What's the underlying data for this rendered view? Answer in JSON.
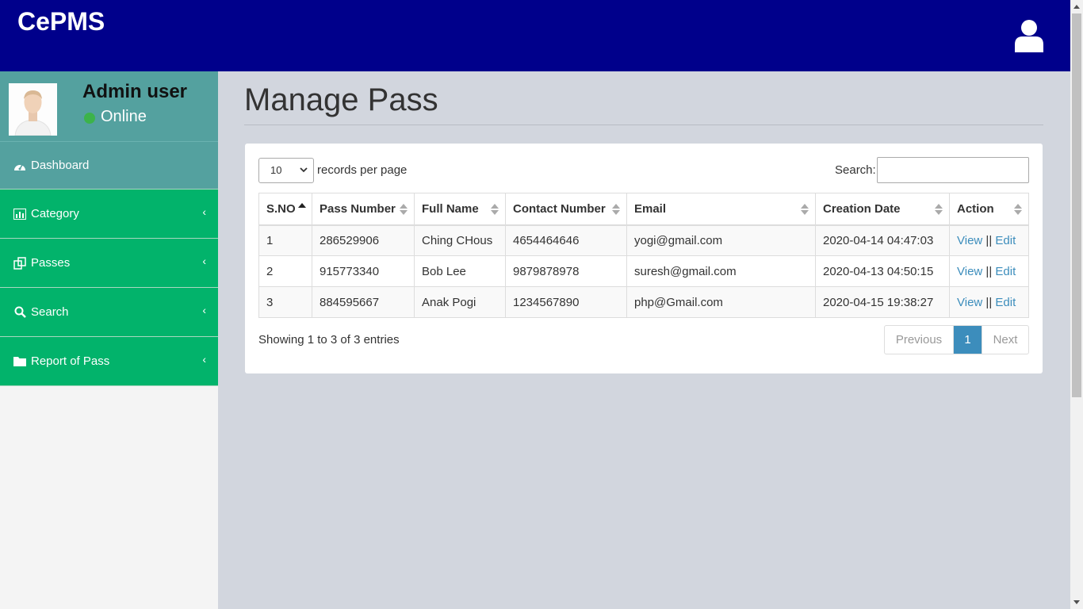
{
  "header": {
    "brand": "CePMS",
    "user_icon": "user-icon"
  },
  "sidebar": {
    "user": {
      "name": "Admin user",
      "status": "Online",
      "status_color": "#3cb34a"
    },
    "items": [
      {
        "label": "Dashboard",
        "icon": "dashboard-icon"
      },
      {
        "label": "Category",
        "icon": "bar-chart-icon"
      },
      {
        "label": "Passes",
        "icon": "copy-icon"
      },
      {
        "label": "Search",
        "icon": "search-icon"
      },
      {
        "label": "Report of Pass",
        "icon": "folder-icon"
      }
    ]
  },
  "page": {
    "title": "Manage Pass"
  },
  "table_controls": {
    "length_value": "10",
    "length_text": "records per page",
    "search_label": "Search:",
    "search_value": ""
  },
  "table": {
    "columns": [
      "S.NO",
      "Pass Number",
      "Full Name",
      "Contact Number",
      "Email",
      "Creation Date",
      "Action"
    ],
    "rows": [
      {
        "sno": "1",
        "pass_number": "286529906",
        "full_name": "Ching CHous",
        "contact": "4654464646",
        "email": "yogi@gmail.com",
        "created": "2020-04-14 04:47:03"
      },
      {
        "sno": "2",
        "pass_number": "915773340",
        "full_name": "Bob Lee",
        "contact": "9879878978",
        "email": "suresh@gmail.com",
        "created": "2020-04-13 04:50:15"
      },
      {
        "sno": "3",
        "pass_number": "884595667",
        "full_name": "Anak Pogi",
        "contact": "1234567890",
        "email": "php@Gmail.com",
        "created": "2020-04-15 19:38:27"
      }
    ],
    "action_view": "View",
    "action_sep": " || ",
    "action_edit": "Edit"
  },
  "footer": {
    "info": "Showing 1 to 3 of 3 entries",
    "prev": "Previous",
    "page": "1",
    "next": "Next"
  },
  "colors": {
    "header": "#00008b",
    "sidebar_teal": "#54a19f",
    "sidebar_green": "#02b36b",
    "link": "#3c8dbc"
  }
}
